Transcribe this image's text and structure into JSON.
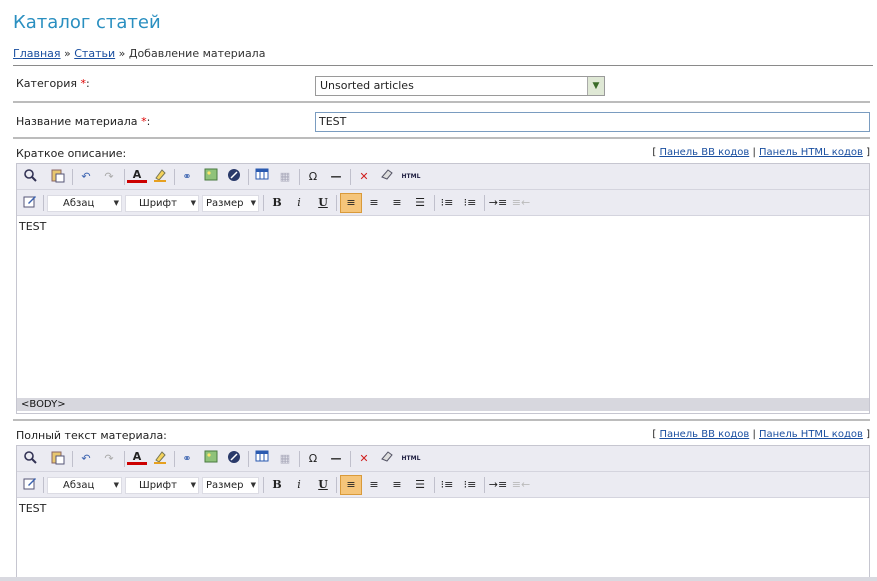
{
  "page": {
    "title": "Каталог статей"
  },
  "breadcrumb": {
    "home": "Главная",
    "sep1": "»",
    "articles": "Статьи",
    "sep2": "»",
    "current": "Добавление материала"
  },
  "form": {
    "category_label": "Категория",
    "name_label": "Название материала",
    "required_mark": "*",
    "colon": ":",
    "category_value": "Unsorted articles",
    "name_value": "TEST",
    "short_label": "Краткое описание:",
    "full_label": "Полный текст материала:"
  },
  "panels": {
    "open": "[",
    "bb": "Панель BB кодов",
    "divider": "|",
    "html": "Панель HTML кодов",
    "close": "]"
  },
  "editor": {
    "format_dropdown": "Абзац",
    "font_dropdown": "Шрифт",
    "size_dropdown": "Размер",
    "html_button": "HTML",
    "bold": "B",
    "italic": "i",
    "underline": "U",
    "special_char": "Ω",
    "short_content": "TEST",
    "full_content": "TEST",
    "status_path": "<BODY>"
  },
  "colors": {
    "title": "#2a8fc0",
    "link": "#1a4fa0",
    "required": "#d00",
    "toolbar": "#ebebf2",
    "active_align": "#f5c57a"
  }
}
